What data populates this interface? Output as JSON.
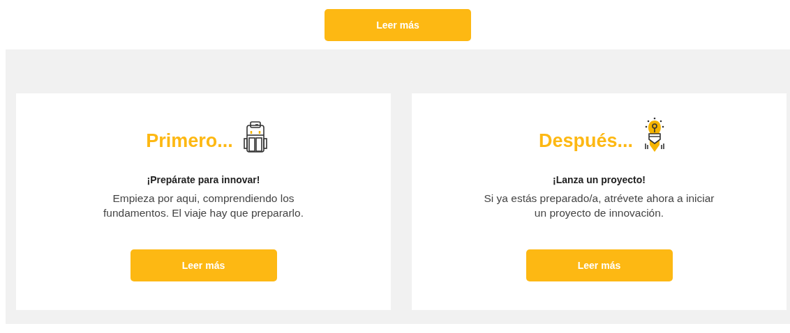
{
  "top_button": "Leer más",
  "cards": [
    {
      "kind": "backpack",
      "title": "Primero...",
      "subtitle": "¡Prepárate para innovar!",
      "text": "Empieza por aqui, comprendiendo los fundamentos. El viaje hay que prepararlo.",
      "button": "Leer más"
    },
    {
      "kind": "rocket",
      "title": "Después...",
      "subtitle": "¡Lanza un proyecto!",
      "text": "Si ya estás preparado/a, atrévete ahora a iniciar un proyecto de innovación.",
      "button": "Leer más"
    }
  ]
}
